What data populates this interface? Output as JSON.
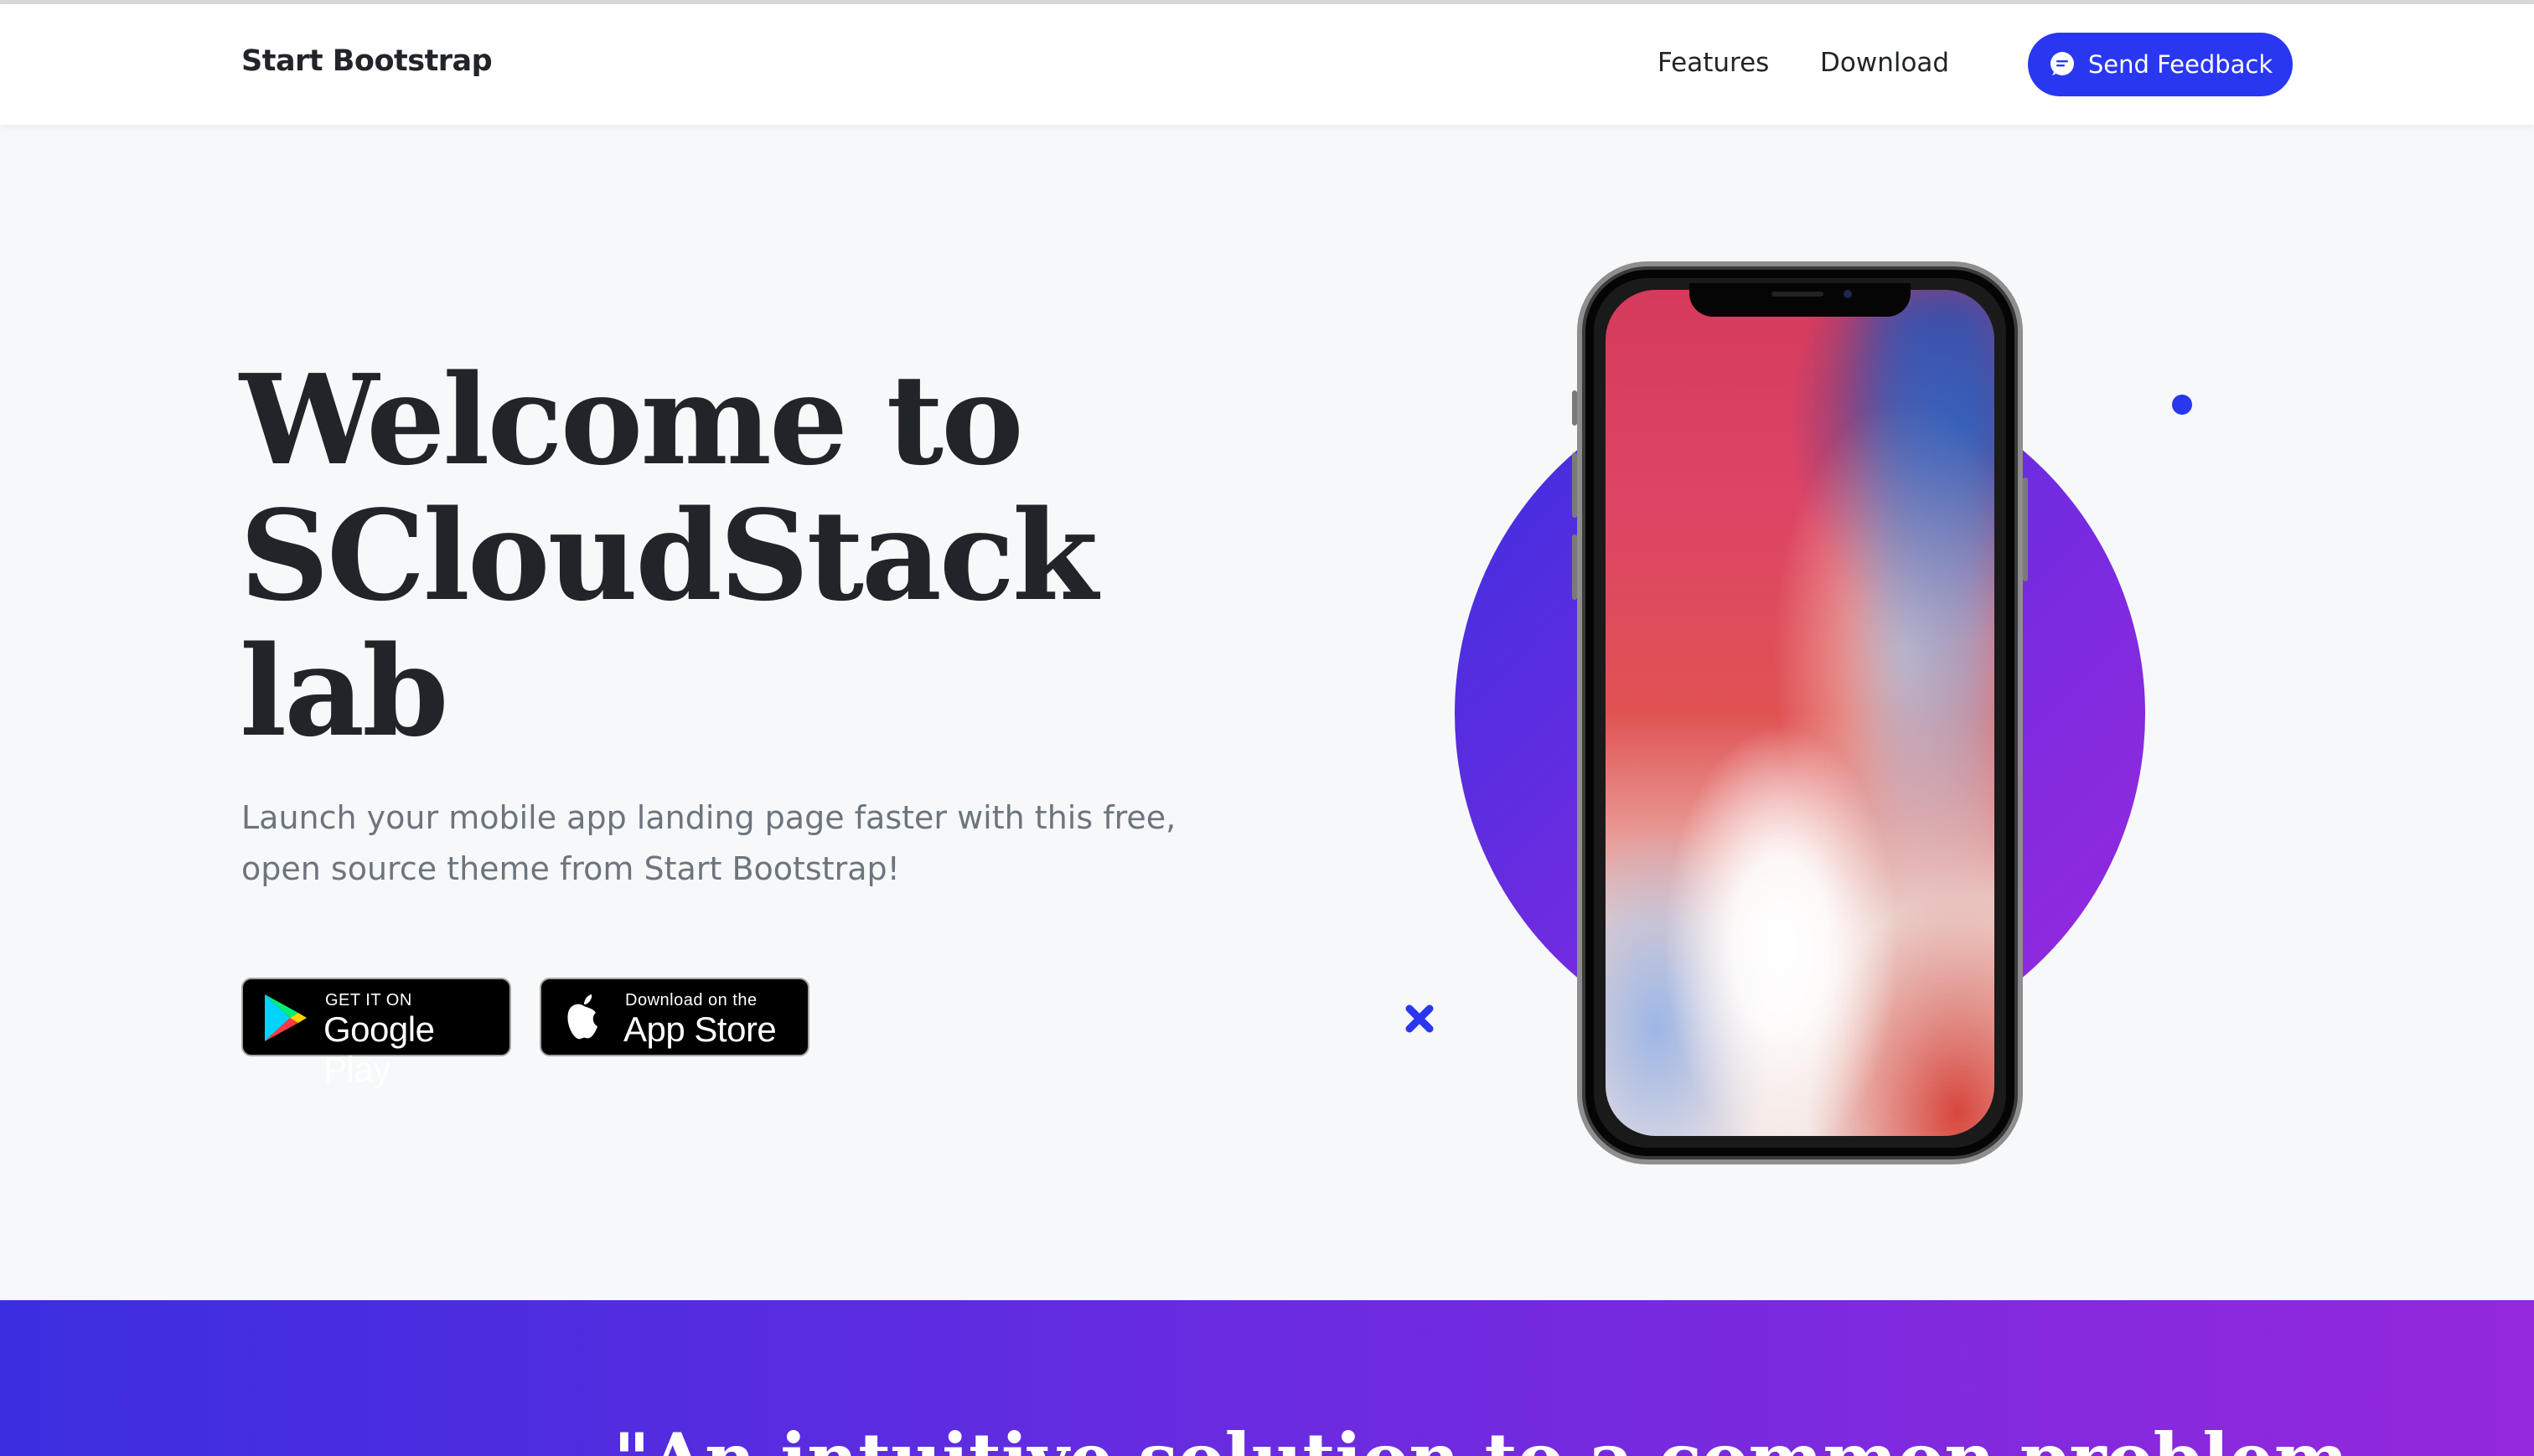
{
  "navbar": {
    "brand": "Start Bootstrap",
    "links": [
      "Features",
      "Download"
    ],
    "feedback_button": "Send Feedback"
  },
  "hero": {
    "title_lines": [
      "Welcome to",
      "SCloudStack",
      "lab"
    ],
    "lead_lines": [
      "Launch your mobile app landing page faster with this free,",
      "open source theme from Start Bootstrap!"
    ],
    "badges": {
      "google": {
        "small": "GET IT ON",
        "big": "Google Play"
      },
      "apple": {
        "small": "Download on the",
        "big": "App Store"
      }
    }
  },
  "quote_band": {
    "partial_text": "\"An intuitive solution to a common problem"
  },
  "colors": {
    "primary": "#2937f0",
    "gradient_start": "#3b2ee0",
    "gradient_end": "#9428dc",
    "text_dark": "#212529",
    "text_muted": "#6c757d"
  },
  "icons": [
    "chat-bubble-icon",
    "google-play-icon",
    "apple-icon",
    "close-x-decoration-icon"
  ]
}
